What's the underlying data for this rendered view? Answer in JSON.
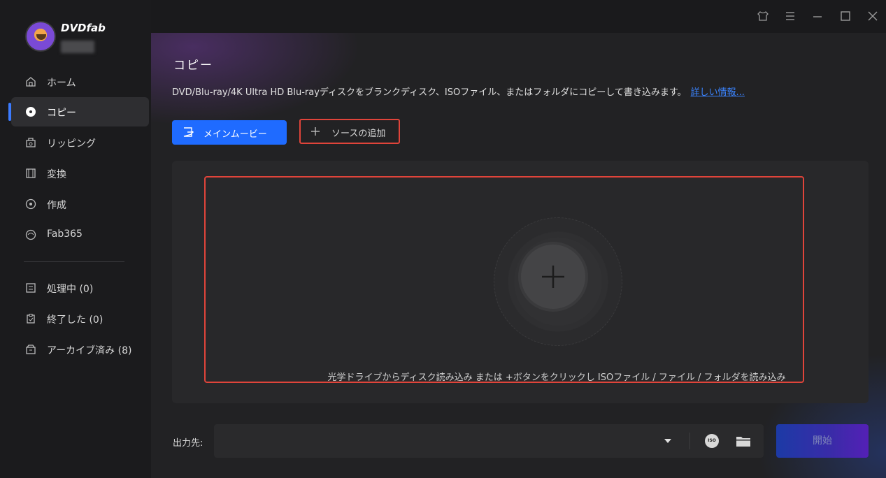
{
  "app": {
    "brand": "DVDfab"
  },
  "sidebar": {
    "items": [
      {
        "label": "ホーム"
      },
      {
        "label": "コピー"
      },
      {
        "label": "リッピング"
      },
      {
        "label": "変換"
      },
      {
        "label": "作成"
      },
      {
        "label": "Fab365"
      }
    ],
    "queue": [
      {
        "label": "処理中 (0)"
      },
      {
        "label": "終了した (0)"
      },
      {
        "label": "アーカイブ済み (8)"
      }
    ]
  },
  "main": {
    "title": "コピー",
    "description": "DVD/Blu-ray/4K Ultra HD Blu-rayディスクをブランクディスク、ISOファイル、またはフォルダにコピーして書き込みます。",
    "more_link": "詳しい情報...",
    "main_movie_button": "メインムービー",
    "add_source_button": "ソースの追加",
    "drop_hint": "光学ドライブからディスク読み込み または +ボタンをクリックし ISOファイル / ファイル / フォルダを読み込み",
    "output_label": "出力先:",
    "output_value": "",
    "iso_icon_text": "ISO",
    "start_button": "開始"
  },
  "colors": {
    "accent": "#1f6bff",
    "highlight": "#e0443a",
    "link": "#3b84ff"
  }
}
